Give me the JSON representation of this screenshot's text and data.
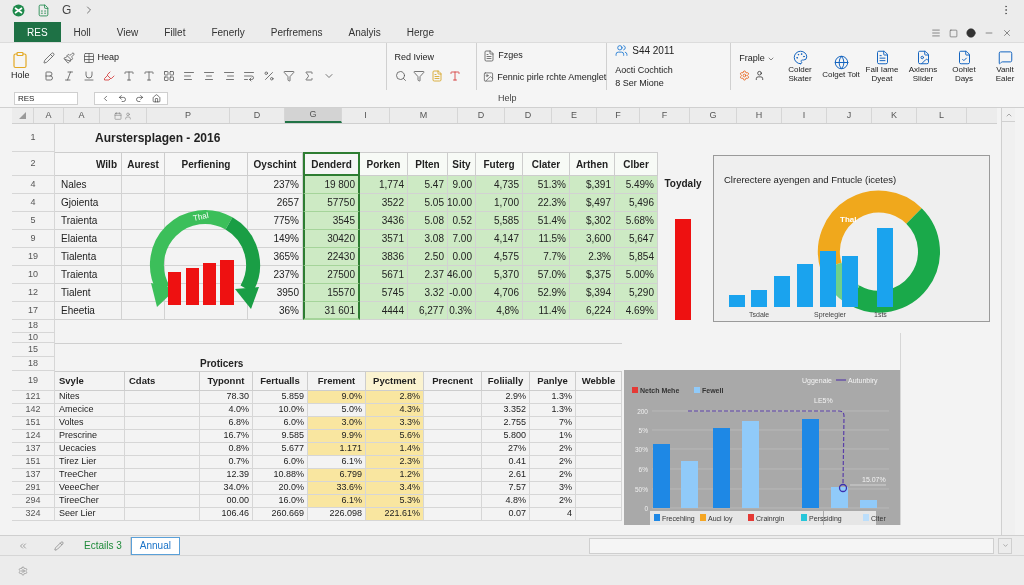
{
  "title_bar": {
    "letter": "G"
  },
  "ribbon_tabs": [
    {
      "label": "RES",
      "selected": true
    },
    {
      "label": "Holl",
      "selected": false
    },
    {
      "label": "View",
      "selected": false
    },
    {
      "label": "Fillet",
      "selected": false
    },
    {
      "label": "Fenerly",
      "selected": false
    },
    {
      "label": "Perfremens",
      "selected": false
    },
    {
      "label": "Analyis",
      "selected": false
    },
    {
      "label": "Herge",
      "selected": false
    }
  ],
  "ribbon": {
    "paste": "Hole",
    "heap": "Heap",
    "review": "Red Iview",
    "pages": "Fzges",
    "arrange": "Fennic pirle rchte Amenglet",
    "version": "S44 2011",
    "account": "Aocti Cochtich",
    "account_more": "8 Ser Mione",
    "people": "Fraple",
    "large_buttons": [
      "Colder Skater",
      "Colget Tolt",
      "Fall Iame Dyeat",
      "Axlenns Slider",
      "Oohlet Days",
      "Vanlt Ealer"
    ],
    "group_label": "Help"
  },
  "name_box": "RES",
  "column_letters": [
    {
      "label": "A",
      "selected": false
    },
    {
      "label": "A",
      "selected": false
    },
    {
      "label": "P",
      "selected": false
    },
    {
      "label": "D",
      "selected": false
    },
    {
      "label": "G",
      "selected": true
    },
    {
      "label": "I",
      "selected": false
    },
    {
      "label": "M",
      "selected": false
    },
    {
      "label": "D",
      "selected": false
    },
    {
      "label": "D",
      "selected": false
    },
    {
      "label": "E",
      "selected": false
    },
    {
      "label": "F",
      "selected": false
    },
    {
      "label": "F",
      "selected": false
    },
    {
      "label": "G",
      "selected": false
    },
    {
      "label": "H",
      "selected": false
    },
    {
      "label": "I",
      "selected": false
    },
    {
      "label": "J",
      "selected": false
    },
    {
      "label": "K",
      "selected": false
    },
    {
      "label": "L",
      "selected": false
    }
  ],
  "top_table": {
    "title_row": "1",
    "title": "Aurstersplagen - 2016",
    "header_row": "2",
    "columns": [
      {
        "label": "Wilb",
        "highlighted": false,
        "selected": false
      },
      {
        "label": "Aurest",
        "highlighted": false,
        "selected": false
      },
      {
        "label": "Perfiening",
        "highlighted": false,
        "selected": false
      },
      {
        "label": "Oyschint",
        "highlighted": false,
        "selected": false
      },
      {
        "label": "Denderd",
        "highlighted": true,
        "selected": true
      },
      {
        "label": "Porken",
        "highlighted": true,
        "selected": false
      },
      {
        "label": "Plten",
        "highlighted": true,
        "selected": false
      },
      {
        "label": "Sity",
        "highlighted": true,
        "selected": false
      },
      {
        "label": "Futerg",
        "highlighted": true,
        "selected": false
      },
      {
        "label": "Clater",
        "highlighted": true,
        "selected": false
      },
      {
        "label": "Arthen",
        "highlighted": true,
        "selected": false
      },
      {
        "label": "Clber",
        "highlighted": true,
        "selected": false
      }
    ],
    "rows": [
      {
        "number": "4",
        "cells": [
          "Nales",
          "",
          "",
          "237%",
          "19 800",
          "1,774",
          "5.47",
          "9.00",
          "4,735",
          "51.3%",
          "$,391",
          "5.49%"
        ]
      },
      {
        "number": "4",
        "cells": [
          "Gjoienta",
          "",
          "",
          "2657",
          "57750",
          "3522",
          "5.05",
          "10.00",
          "1,700",
          "22.3%",
          "$,497",
          "5,496"
        ]
      },
      {
        "number": "5",
        "cells": [
          "Traienta",
          "",
          "",
          "775%",
          "3545",
          "3436",
          "5.08",
          "0.52",
          "5,585",
          "51.4%",
          "$,302",
          "5.68%"
        ]
      },
      {
        "number": "9",
        "cells": [
          "Elaienta",
          "",
          "",
          "149%",
          "30420",
          "3571",
          "3.08",
          "7.00",
          "4,147",
          "11.5%",
          "3,600",
          "5,647"
        ]
      },
      {
        "number": "19",
        "cells": [
          "Tialenta",
          "",
          "",
          "365%",
          "22430",
          "3836",
          "2.50",
          "0.00",
          "4,575",
          "7.7%",
          "2.3%",
          "5,854"
        ]
      },
      {
        "number": "10",
        "cells": [
          "Traienta",
          "",
          "",
          "237%",
          "27500",
          "5671",
          "2.37",
          "46.00",
          "5,370",
          "57.0%",
          "$,375",
          "5.00%"
        ]
      },
      {
        "number": "12",
        "cells": [
          "Tialent",
          "",
          "",
          "3950",
          "15570",
          "5745",
          "3.32",
          "-0.00",
          "4,706",
          "52.9%",
          "$,394",
          "5,290"
        ]
      },
      {
        "number": "17",
        "cells": [
          "Eheetia",
          "",
          "",
          "36%",
          "31 601",
          "4444",
          "6,277",
          "0.3%",
          "4,8%",
          "11.4%",
          "6,224",
          "4.69%"
        ]
      }
    ],
    "end_row": "18",
    "gauge_label": "Thal"
  },
  "side_column": {
    "heading": "Toydaly"
  },
  "trend_chart": {
    "title": "Clrerectere ayengen and Fntucle (icetes)",
    "donut_label": "Thal",
    "axis_labels": [
      "Tsdale",
      "Sprelegier",
      "1sts"
    ]
  },
  "bottom_table": {
    "rows_above": [
      "10",
      "15"
    ],
    "title_row": "18",
    "title": "Proticers",
    "header_row": "19",
    "columns": [
      {
        "label": "Svyle",
        "highlighted": false
      },
      {
        "label": "Cdats",
        "highlighted": false
      },
      {
        "label": "Typonnt",
        "highlighted": false
      },
      {
        "label": "Fertualls",
        "highlighted": false
      },
      {
        "label": "Frement",
        "highlighted": false,
        "follows_row_mark": true
      },
      {
        "label": "Pyctment",
        "highlighted": true
      },
      {
        "label": "Precnent",
        "highlighted": false
      },
      {
        "label": "Foliially",
        "highlighted": false
      },
      {
        "label": "Panlye",
        "highlighted": false
      },
      {
        "label": "Webble",
        "highlighted": false
      }
    ],
    "rows": [
      {
        "number": "121",
        "marked": true,
        "cells": [
          "Nites",
          "",
          "78.30",
          "5.859",
          "9.0%",
          "2.8%",
          "",
          "2.9%",
          "1.3%",
          ""
        ]
      },
      {
        "number": "142",
        "marked": false,
        "cells": [
          "Amecice",
          "",
          "4.0%",
          "10.0%",
          "5.0%",
          "4.3%",
          "",
          "3.352",
          "1.3%",
          ""
        ]
      },
      {
        "number": "151",
        "marked": true,
        "cells": [
          "Voltes",
          "",
          "6.8%",
          "6.0%",
          "3.0%",
          "3.3%",
          "",
          "2.755",
          "7%",
          ""
        ]
      },
      {
        "number": "124",
        "marked": true,
        "cells": [
          "Prescrine",
          "",
          "16.7%",
          "9.585",
          "9.9%",
          "5.6%",
          "",
          "5.800",
          "1%",
          ""
        ]
      },
      {
        "number": "137",
        "marked": true,
        "cells": [
          "Uecacies",
          "",
          "0.8%",
          "5.677",
          "1.171",
          "1.4%",
          "",
          "27%",
          "2%",
          ""
        ]
      },
      {
        "number": "151",
        "marked": false,
        "cells": [
          "Tirez Lier",
          "",
          "0.7%",
          "6.0%",
          "6.1%",
          "2.3%",
          "",
          "0.41",
          "2%",
          ""
        ]
      },
      {
        "number": "137",
        "marked": true,
        "cells": [
          "TreeCher",
          "",
          "12.39",
          "10.88%",
          "6.799",
          "1.2%",
          "",
          "2.61",
          "2%",
          ""
        ]
      },
      {
        "number": "291",
        "marked": true,
        "cells": [
          "VeeeCher",
          "",
          "34.0%",
          "20.0%",
          "33.6%",
          "3.4%",
          "",
          "7.57",
          "3%",
          ""
        ]
      },
      {
        "number": "294",
        "marked": true,
        "cells": [
          "TireeCher",
          "",
          "00.00",
          "16.0%",
          "6.1%",
          "5.3%",
          "",
          "4.8%",
          "2%",
          ""
        ]
      },
      {
        "number": "324",
        "marked": false,
        "cells": [
          "Seer Lier",
          "",
          "106.46",
          "260.669",
          "226.098",
          "221.61%",
          "",
          "0.07",
          "4",
          ""
        ]
      }
    ]
  },
  "bar_chart": {
    "legend_top": [
      {
        "label": "Netch Mehe",
        "color": "#e53935"
      },
      {
        "label": "Fewell",
        "color": "#90caf9"
      }
    ],
    "series_label": "Uggenaie",
    "line_label": "Autunbiry",
    "yticks": [
      "200",
      "5%",
      "30%",
      "6%",
      "50%",
      "0"
    ],
    "annotations": [
      "LE5%",
      "15.07%"
    ],
    "legend_bottom": [
      {
        "label": "Frecehling",
        "color": "#1e88e5"
      },
      {
        "label": "Aucl loy",
        "color": "#f5a623"
      },
      {
        "label": "Crainrgin",
        "color": "#e53935"
      },
      {
        "label": "Perssiding",
        "color": "#26c6da"
      },
      {
        "label": "Clter",
        "color": "#bbdefb"
      }
    ]
  },
  "sheet_tabs": [
    {
      "label": "Ectails 3",
      "selected": false
    },
    {
      "label": "Annual",
      "selected": true
    }
  ]
}
